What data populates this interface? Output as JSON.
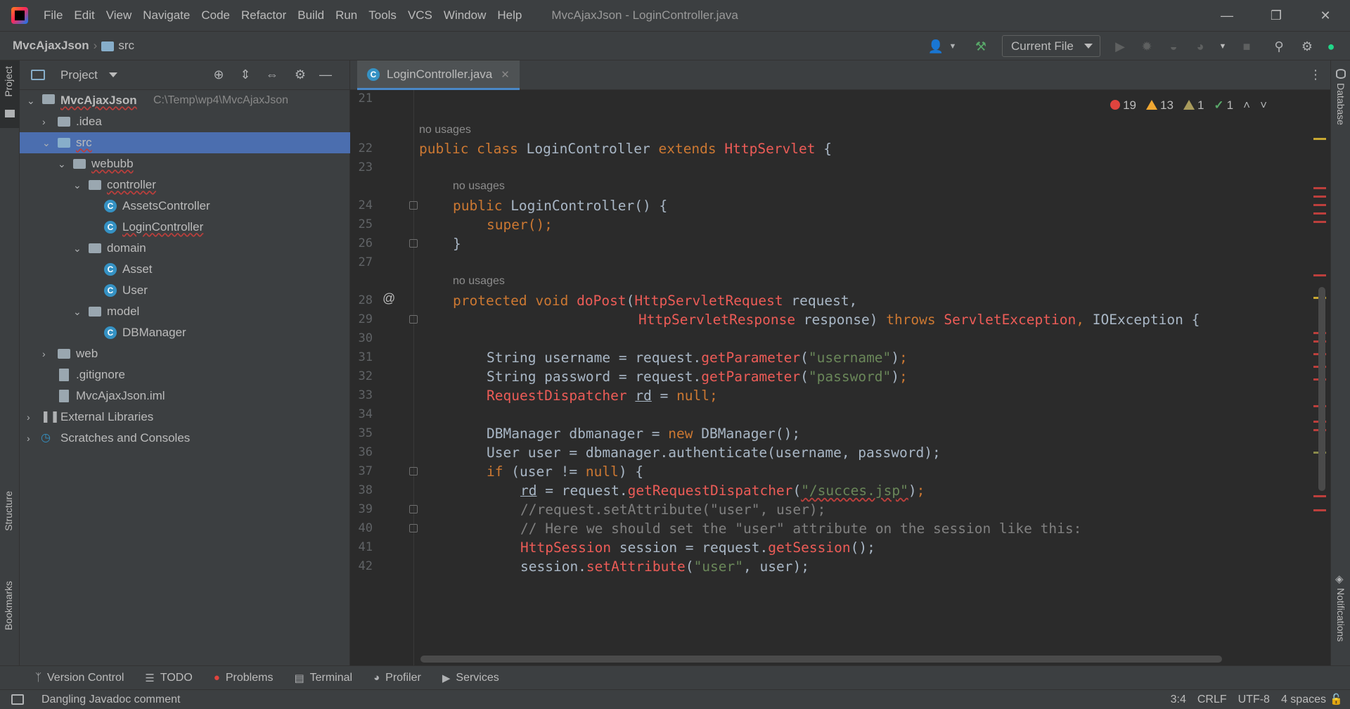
{
  "menubar": {
    "items": [
      "File",
      "Edit",
      "View",
      "Navigate",
      "Code",
      "Refactor",
      "Build",
      "Run",
      "Tools",
      "VCS",
      "Window",
      "Help"
    ],
    "window_title": "MvcAjaxJson - LoginController.java"
  },
  "navbar": {
    "breadcrumb_root": "MvcAjaxJson",
    "breadcrumb_child": "src",
    "run_config": "Current File"
  },
  "project_panel": {
    "title": "Project",
    "tree": {
      "root_name": "MvcAjaxJson",
      "root_path": "C:\\Temp\\wp4\\MvcAjaxJson",
      "idea": ".idea",
      "src": "src",
      "webubb": "webubb",
      "controller": "controller",
      "assets_controller": "AssetsController",
      "login_controller": "LoginController",
      "domain": "domain",
      "asset": "Asset",
      "user": "User",
      "model": "model",
      "dbmanager": "DBManager",
      "web": "web",
      "gitignore": ".gitignore",
      "iml": "MvcAjaxJson.iml",
      "external_libraries": "External Libraries",
      "scratches": "Scratches and Consoles"
    }
  },
  "editor": {
    "tab_label": "LoginController.java",
    "inspections": {
      "errors": "19",
      "warnings": "13",
      "weak_warnings": "1",
      "ok": "1"
    },
    "usage_hint": "no usages",
    "line_numbers": [
      "21",
      "22",
      "23",
      "24",
      "25",
      "26",
      "27",
      "28",
      "29",
      "30",
      "31",
      "32",
      "33",
      "34",
      "35",
      "36",
      "37",
      "38",
      "39",
      "40",
      "41",
      "42"
    ],
    "code": {
      "l22_public_class": "public class ",
      "l22_name": "LoginController ",
      "l22_extends": "extends ",
      "l22_super": "HttpServlet",
      "l22_brace": " {",
      "l24_public": "public ",
      "l24_ctor": "LoginController",
      "l24_rest": "() {",
      "l25": "super",
      "l25_rest": "();",
      "l26": "}",
      "l28_mod": "protected void ",
      "l28_name": "doPost",
      "l28_paren": "(",
      "l28_type": "HttpServletRequest",
      "l28_rest": " request,",
      "l29_type": "HttpServletResponse",
      "l29_mid": " response) ",
      "l29_throws": "throws ",
      "l29_ex1": "ServletException",
      "l29_comma": ", ",
      "l29_ex2": "IOException",
      "l29_brace": " {",
      "l31_a": "String username = request.",
      "l31_fn": "getParameter",
      "l31_str": "\"username\"",
      "l32_a": "String password = request.",
      "l32_fn": "getParameter",
      "l32_str": "\"password\"",
      "l33_type": "RequestDispatcher",
      "l33_var": "rd",
      "l33_null": "null",
      "l35_a": "DBManager dbmanager = ",
      "l35_new": "new",
      "l35_b": " DBManager();",
      "l36": "User user = dbmanager.authenticate(username, password);",
      "l37_if": "if",
      "l37_a": " (user != ",
      "l37_null": "null",
      "l37_b": ") {",
      "l38_var": "rd",
      "l38_a": " = request.",
      "l38_fn": "getRequestDispatcher",
      "l38_str": "\"/succes.jsp\"",
      "l39": "//request.setAttribute(\"user\", user);",
      "l40": "// Here we should set the \"user\" attribute on the session like this:",
      "l41_type": "HttpSession",
      "l41_a": " session = request.",
      "l41_fn": "getSession",
      "l41_b": "();",
      "l42_a": "session.",
      "l42_fn": "setAttribute",
      "l42_str": "\"user\"",
      "l42_b": ", user);"
    }
  },
  "bottom_tabs": [
    "Version Control",
    "TODO",
    "Problems",
    "Terminal",
    "Profiler",
    "Services"
  ],
  "left_strip": {
    "project": "Project",
    "structure": "Structure",
    "bookmarks": "Bookmarks"
  },
  "right_strip": {
    "database": "Database",
    "notifications": "Notifications"
  },
  "statusbar": {
    "message": "Dangling Javadoc comment",
    "position": "3:4",
    "line_sep": "CRLF",
    "encoding": "UTF-8",
    "indent": "4 spaces"
  },
  "colors": {
    "accent": "#4b6eaf",
    "error": "#e0443e",
    "keyword": "#cc7832",
    "string": "#6a8759"
  }
}
